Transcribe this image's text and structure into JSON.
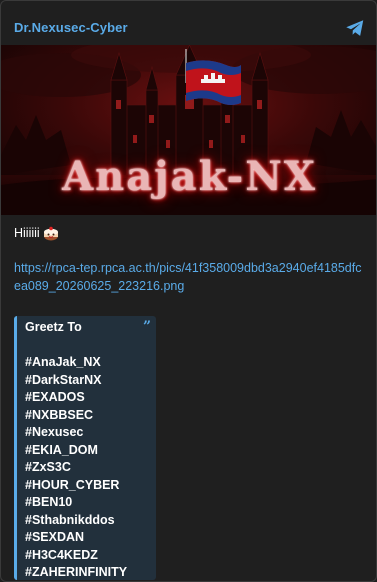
{
  "header": {
    "channel_name": "Dr.Nexusec-Cyber",
    "share_icon": "telegram-send-icon",
    "accent_color": "#5aabe8"
  },
  "banner": {
    "text": "Anajak-NX",
    "flag": "cambodia-flag"
  },
  "message": {
    "greeting": "Hiiiiii",
    "emoji": "cake-face-emoji",
    "link": "https://rpca-tep.rpca.ac.th/pics/41f358009dbd3a2940ef4185dfcea089_20260625_223216.png"
  },
  "quote": {
    "title": "Greetz To",
    "mark": "”",
    "tags": [
      "#AnaJak_NX",
      "#DarkStarNX",
      "#EXADOS",
      "#NXBBSEC",
      "#Nexusec",
      "#EKIA_DOM",
      "#ZxS3C",
      "#HOUR_CYBER",
      "#BEN10",
      "#Sthabnikddos",
      "#SEXDAN",
      "#H3C4KEDZ",
      "#ZAHERINFINITY"
    ],
    "background": "#22303c"
  }
}
